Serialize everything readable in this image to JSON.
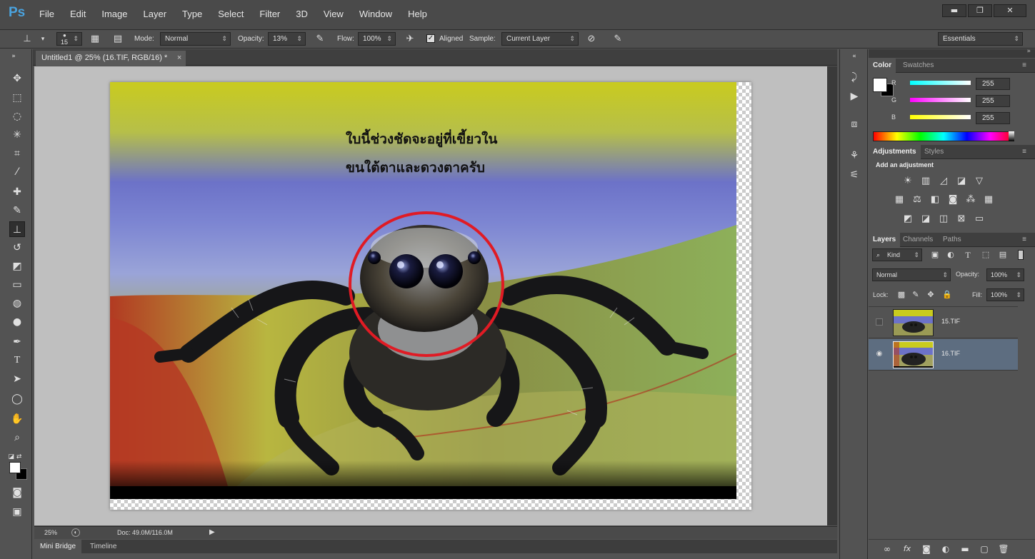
{
  "app": {
    "logo": "Ps",
    "menu": [
      "File",
      "Edit",
      "Image",
      "Layer",
      "Type",
      "Select",
      "Filter",
      "3D",
      "View",
      "Window",
      "Help"
    ],
    "window_controls": [
      "▬",
      "❐",
      "✕"
    ]
  },
  "options": {
    "brush_size": "15",
    "mode_label": "Mode:",
    "mode_value": "Normal",
    "opacity_label": "Opacity:",
    "opacity_value": "13%",
    "flow_label": "Flow:",
    "flow_value": "100%",
    "aligned_label": "Aligned",
    "aligned_checked": true,
    "sample_label": "Sample:",
    "sample_value": "Current Layer",
    "workspace": "Essentials"
  },
  "document": {
    "tab_title": "Untitled1 @ 25% (16.TIF, RGB/16) *",
    "annotation_line1": "ใบนี้ช่วงชัดจะอยู่ที่เขี้ยวใน",
    "annotation_line2": "ขนใต้ตาและดวงตาครับ",
    "highlight_color": "#e01b24"
  },
  "status": {
    "zoom": "25%",
    "doc_size": "Doc: 49.0M/116.0M"
  },
  "bottom_tabs": [
    "Mini Bridge",
    "Timeline"
  ],
  "color_panel": {
    "tabs": [
      "Color",
      "Swatches"
    ],
    "channels": [
      {
        "label": "R",
        "value": "255",
        "color": "#00ffff"
      },
      {
        "label": "G",
        "value": "255",
        "color": "#ff00ff"
      },
      {
        "label": "B",
        "value": "255",
        "color": "#ffff00"
      }
    ]
  },
  "adjustments_panel": {
    "tabs": [
      "Adjustments",
      "Styles"
    ],
    "heading": "Add an adjustment",
    "icons": [
      [
        "brightness-icon",
        "levels-icon",
        "curves-icon",
        "exposure-icon",
        "vibrance-icon"
      ],
      [
        "hue-saturation-icon",
        "color-balance-icon",
        "black-white-icon",
        "photo-filter-icon",
        "channel-mixer-icon",
        "color-lookup-icon"
      ],
      [
        "invert-icon",
        "posterize-icon",
        "threshold-icon",
        "selective-color-icon",
        "gradient-map-icon"
      ]
    ]
  },
  "layers_panel": {
    "tabs": [
      "Layers",
      "Channels",
      "Paths"
    ],
    "filter_kind": "Kind",
    "blend_mode": "Normal",
    "opacity_label": "Opacity:",
    "opacity_value": "100%",
    "lock_label": "Lock:",
    "fill_label": "Fill:",
    "fill_value": "100%",
    "layers": [
      {
        "name": "15.TIF",
        "visible": false,
        "selected": false
      },
      {
        "name": "16.TIF",
        "visible": true,
        "selected": true
      }
    ]
  }
}
